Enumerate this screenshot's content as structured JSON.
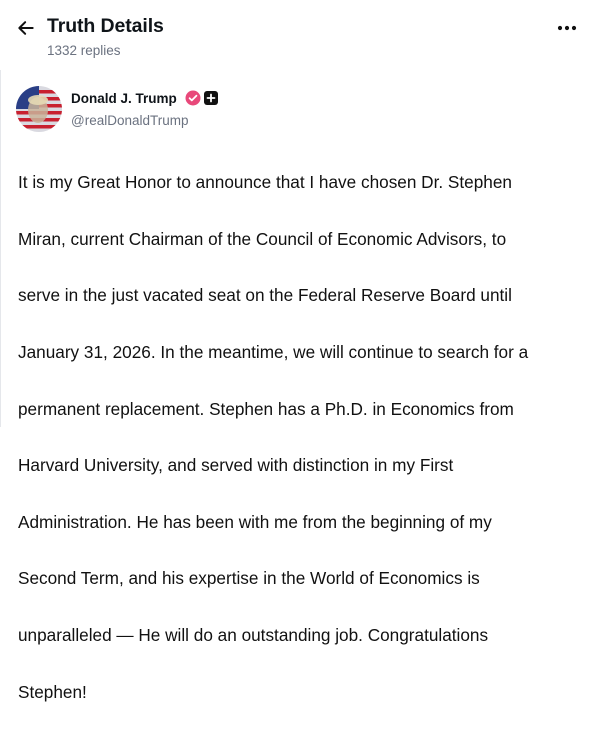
{
  "header": {
    "title": "Truth Details",
    "subtitle": "1332 replies",
    "back_icon": "arrow-left-icon",
    "more_icon": "more-horizontal-icon"
  },
  "post": {
    "author_name": "Donald J. Trump",
    "handle": "@realDonaldTrump",
    "verified_icon": "verified-badge-icon",
    "plus_icon": "plus-badge-icon",
    "text_lines": [
      "It is my Great Honor to announce that I have chosen Dr. Stephen",
      "Miran, current Chairman of the Council of Economic Advisors, to",
      "serve in the just vacated seat on the Federal Reserve Board until",
      "January 31, 2026. In the meantime, we will continue to search for a",
      "permanent replacement. Stephen has a Ph.D. in Economics from",
      "Harvard University, and served with distinction in my First",
      "Administration. He has been with me from the beginning of my",
      "Second Term, and his expertise in the World of Economics is",
      "unparalleled — He will do an outstanding job. Congratulations",
      "Stephen!"
    ]
  },
  "colors": {
    "verified": "#e8487a",
    "muted_text": "#6b7280",
    "primary_text": "#111111"
  }
}
